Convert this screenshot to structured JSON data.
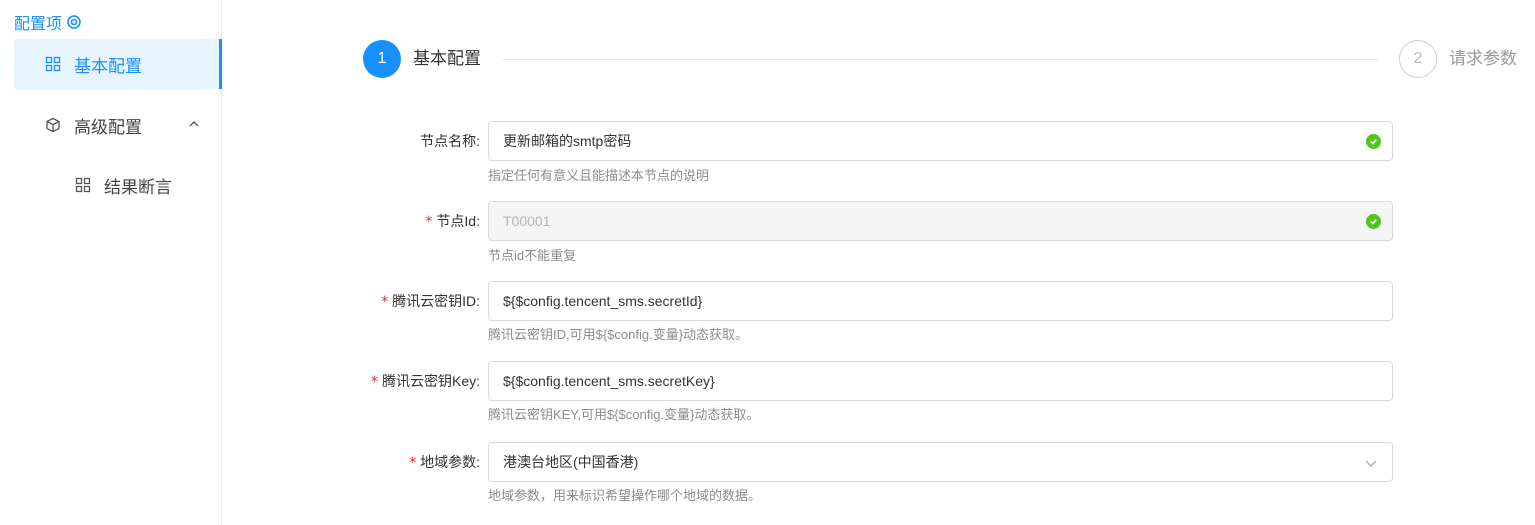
{
  "sidebar": {
    "title": "配置项",
    "items": [
      {
        "label": "基本配置"
      },
      {
        "label": "高级配置"
      },
      {
        "label": "结果断言"
      }
    ]
  },
  "steps": [
    {
      "number": "1",
      "label": "基本配置"
    },
    {
      "number": "2",
      "label": "请求参数"
    }
  ],
  "form": {
    "fields": [
      {
        "label": "节点名称:",
        "value": "更新邮箱的smtp密码",
        "help": "指定任何有意义且能描述本节点的说明"
      },
      {
        "label": "节点Id:",
        "value": "T00001",
        "help": "节点id不能重复"
      },
      {
        "label": "腾讯云密钥ID:",
        "value": "${$config.tencent_sms.secretId}",
        "help": "腾讯云密钥ID,可用${$config.变量}动态获取。"
      },
      {
        "label": "腾讯云密钥Key:",
        "value": "${$config.tencent_sms.secretKey}",
        "help": "腾讯云密钥KEY,可用${$config.变量}动态获取。"
      },
      {
        "label": "地域参数:",
        "value": "港澳台地区(中国香港)",
        "help": "地域参数，用来标识希望操作哪个地域的数据。"
      }
    ],
    "required_mark": "*"
  },
  "colors": {
    "accent": "#1890ff",
    "success": "#52c41a",
    "required": "#f5222d"
  }
}
